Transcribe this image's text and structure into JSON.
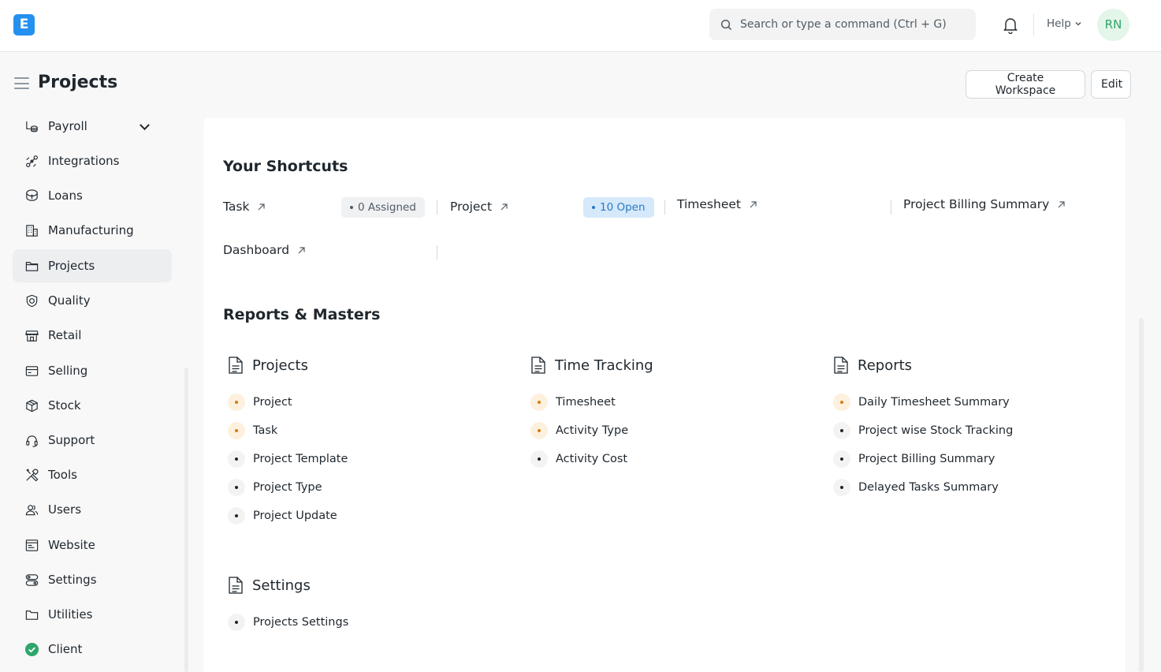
{
  "navbar": {
    "logo_letter": "E",
    "search_placeholder": "Search or type a command (Ctrl + G)",
    "help_label": "Help",
    "avatar_initials": "RN"
  },
  "page": {
    "title": "Projects",
    "create_workspace_label": "Create Workspace",
    "edit_label": "Edit"
  },
  "sidebar": {
    "items": [
      {
        "label": "Payroll",
        "icon": "money-stack-icon"
      },
      {
        "label": "Integrations",
        "icon": "integration-icon"
      },
      {
        "label": "Loans",
        "icon": "loan-icon"
      },
      {
        "label": "Manufacturing",
        "icon": "factory-icon"
      },
      {
        "label": "Projects",
        "icon": "folder-icon"
      },
      {
        "label": "Quality",
        "icon": "quality-icon"
      },
      {
        "label": "Retail",
        "icon": "store-icon"
      },
      {
        "label": "Selling",
        "icon": "selling-icon"
      },
      {
        "label": "Stock",
        "icon": "box-icon"
      },
      {
        "label": "Support",
        "icon": "headset-icon"
      },
      {
        "label": "Tools",
        "icon": "tools-icon"
      },
      {
        "label": "Users",
        "icon": "users-icon"
      },
      {
        "label": "Website",
        "icon": "website-icon"
      },
      {
        "label": "Settings",
        "icon": "settings-icon"
      },
      {
        "label": "Utilities",
        "icon": "folder-icon"
      },
      {
        "label": "Client",
        "icon": "check-circle-icon"
      }
    ]
  },
  "shortcuts": {
    "title": "Your Shortcuts",
    "items": [
      {
        "label": "Task",
        "badge": "0 Assigned"
      },
      {
        "label": "Project",
        "badge": "10 Open"
      },
      {
        "label": "Timesheet"
      },
      {
        "label": "Project Billing Summary"
      },
      {
        "label": "Dashboard"
      }
    ]
  },
  "reports": {
    "title": "Reports & Masters",
    "cards": [
      {
        "title": "Projects",
        "links": [
          "Project",
          "Task",
          "Project Template",
          "Project Type",
          "Project Update"
        ]
      },
      {
        "title": "Time Tracking",
        "links": [
          "Timesheet",
          "Activity Type",
          "Activity Cost"
        ]
      },
      {
        "title": "Reports",
        "links": [
          "Daily Timesheet Summary",
          "Project wise Stock Tracking",
          "Project Billing Summary",
          "Delayed Tasks Summary"
        ]
      },
      {
        "title": "Settings",
        "links": [
          "Projects Settings"
        ]
      }
    ]
  },
  "colors": {
    "brand": "#2490ef",
    "orange_dot": "#d17c1c",
    "blue_pill": "#2a7ac1",
    "avatar_green": "#30a66d",
    "client_green": "#30a66d"
  }
}
